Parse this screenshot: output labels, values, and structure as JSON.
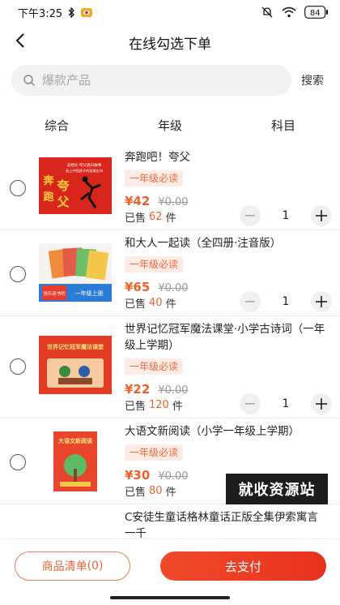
{
  "status": {
    "time": "下午3:25",
    "battery": "84",
    "icons": [
      "bluetooth-icon",
      "eye-icon",
      "mute-icon",
      "wifi-icon",
      "battery-icon"
    ]
  },
  "header": {
    "title": "在线勾选下单",
    "back_icon": "chevron-left-icon"
  },
  "search": {
    "placeholder": "爆款产品",
    "button_label": "搜索"
  },
  "sort_tabs": [
    "综合",
    "年级",
    "科目"
  ],
  "products": [
    {
      "name": "奔跑吧！夸父",
      "tag": "一年级必读",
      "price": "¥42",
      "original_price": "¥0.00",
      "sold_prefix": "已售",
      "sold": "62",
      "sold_unit": "件",
      "qty": "1"
    },
    {
      "name": "和大人一起读（全四册·注音版）",
      "tag": "一年级必读",
      "price": "¥65",
      "original_price": "¥0.00",
      "sold_prefix": "已售",
      "sold": "40",
      "sold_unit": "件",
      "qty": "1"
    },
    {
      "name": "世界记忆冠军魔法课堂·小学古诗词（一年级上学期）",
      "tag": "一年级必读",
      "price": "¥22",
      "original_price": "¥0.00",
      "sold_prefix": "已售",
      "sold": "120",
      "sold_unit": "件",
      "qty": "1"
    },
    {
      "name": "大语文新阅读（小学一年级上学期）",
      "tag": "一年级必读",
      "price": "¥30",
      "original_price": "¥0.00",
      "sold_prefix": "已售",
      "sold": "80",
      "sold_unit": "件",
      "qty": "1"
    },
    {
      "name": "C安徒生童话格林童话正版全集伊索寓言 一千"
    }
  ],
  "covers": {
    "book1": {
      "title_lines": [
        "夸",
        "奔",
        "父",
        "跑"
      ],
      "top_text": "吴经纶·夸父逐日故事",
      "sub_text": "画上中国孩子的英雄史诗"
    },
    "book2": {
      "badge": "快乐读书吧",
      "band": "一年级上册"
    },
    "book3": {
      "title": "世界记忆冠军魔法课堂"
    },
    "book4": {
      "title": "大语文新阅读"
    }
  },
  "watermark": "就收资源站",
  "bottom": {
    "cart_label": "商品清单",
    "cart_count": "(0)",
    "pay_label": "去支付"
  },
  "colors": {
    "accent": "#f0602a",
    "tag_bg": "#fdece6",
    "pay_gradient_start": "#f04a2a",
    "pay_gradient_end": "#e8321e"
  }
}
